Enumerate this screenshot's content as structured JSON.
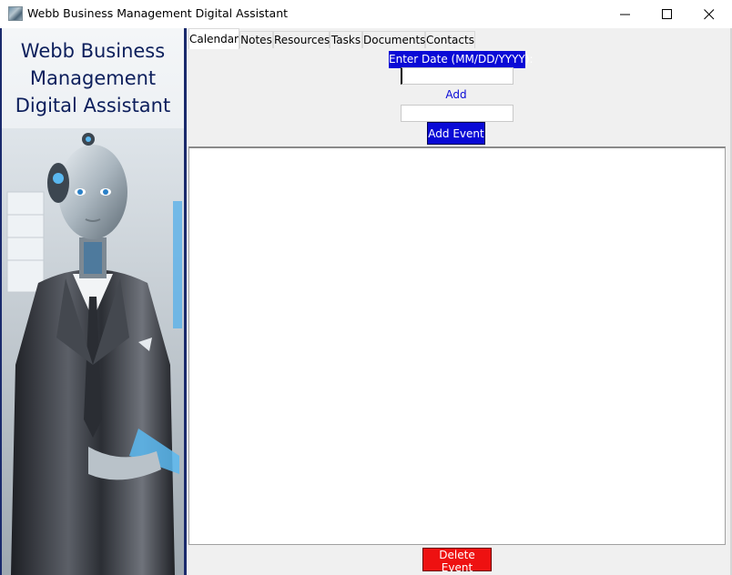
{
  "window": {
    "title": "Webb Business Management Digital Assistant",
    "controls": [
      "minimize",
      "maximize",
      "close"
    ]
  },
  "banner": {
    "title_lines": [
      "Webb Business",
      "Management",
      "Digital Assistant"
    ]
  },
  "tabs": [
    {
      "label": "Calendar",
      "active": true
    },
    {
      "label": "Notes",
      "active": false
    },
    {
      "label": "Resources",
      "active": false
    },
    {
      "label": "Tasks",
      "active": false
    },
    {
      "label": "Documents",
      "active": false
    },
    {
      "label": "Contacts",
      "active": false
    }
  ],
  "calendar": {
    "date_label": "Enter Date (MM/DD/YYYY):",
    "date_value": "",
    "event_label": "Add Event:",
    "event_value": "",
    "add_button": "Add Event",
    "events": [],
    "delete_button": "Delete Event"
  },
  "colors": {
    "accent_blue": "#0a0ad6",
    "delete_red": "#ee1111",
    "banner_title": "#0d1f5c"
  }
}
